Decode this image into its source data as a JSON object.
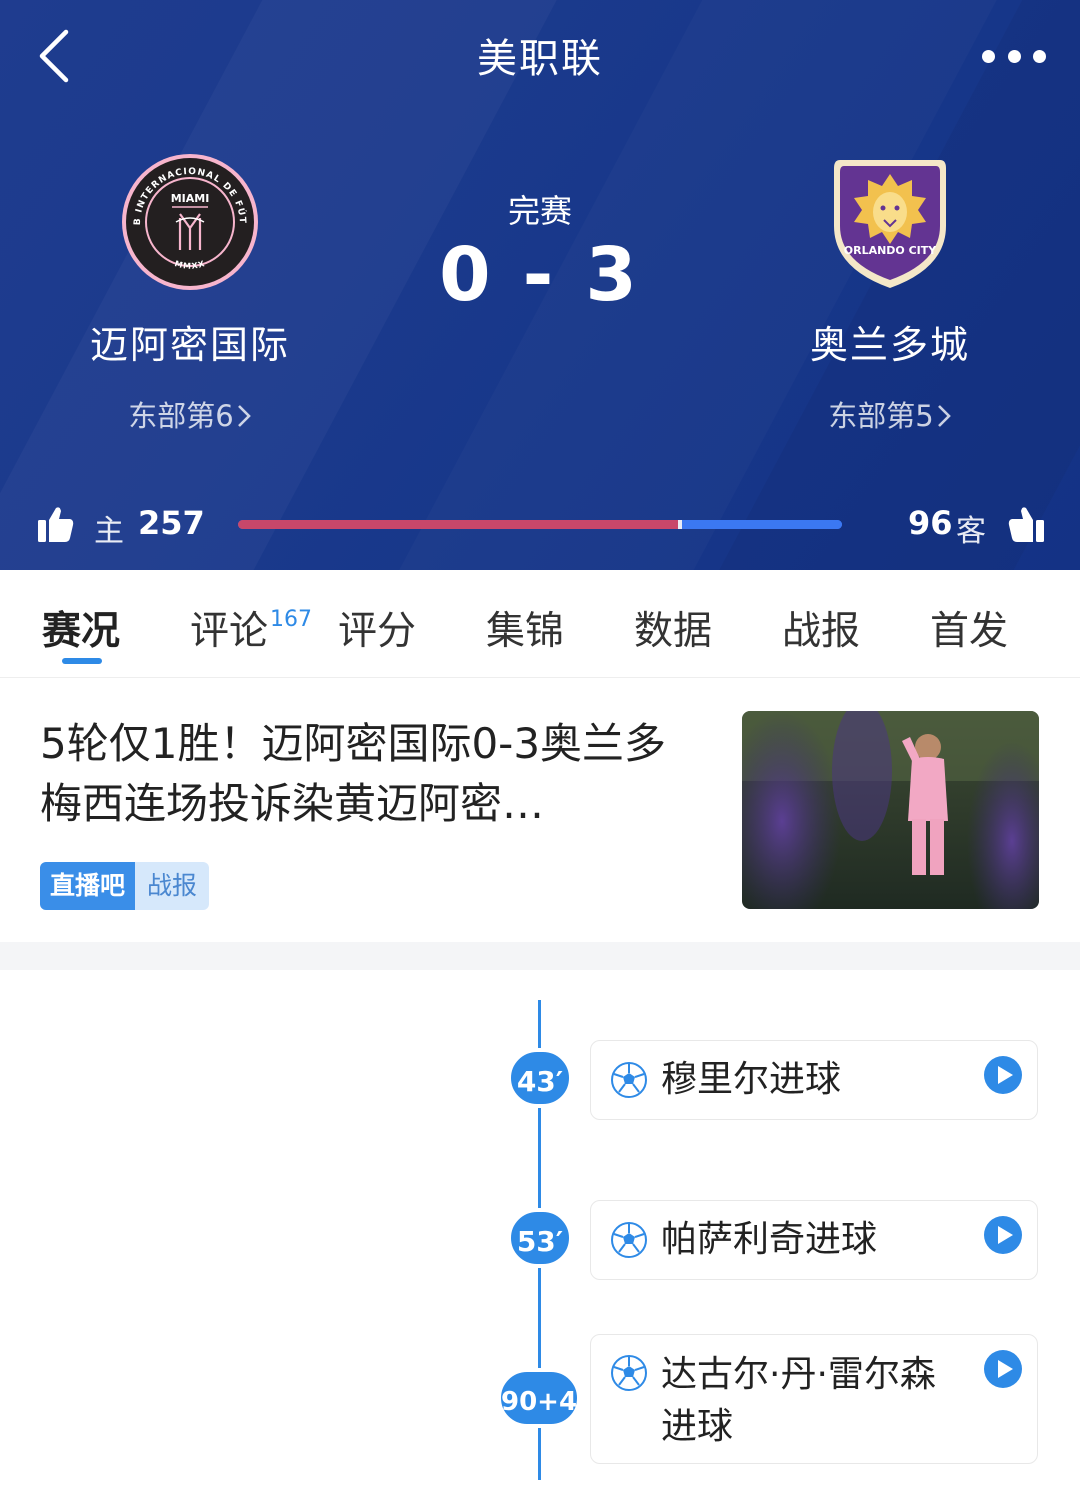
{
  "header": {
    "title": "美职联",
    "status": "完赛",
    "score": {
      "home": "0",
      "separator": "-",
      "away": "3"
    },
    "home_team": {
      "name": "迈阿密国际",
      "rank": "东部第6",
      "logo_text_top": "CLUB INTERNACIONAL DE FÚTBOL",
      "logo_text_center": "MIAMI",
      "logo_text_bottom": "MMXX"
    },
    "away_team": {
      "name": "奥兰多城",
      "rank": "东部第5",
      "logo_text": "ORLANDO CITY"
    },
    "vote": {
      "home_label": "主",
      "home_count": "257",
      "away_count": "96",
      "away_label": "客",
      "home_share": 0.728
    },
    "colors": {
      "background": "#1b3a8c",
      "home_bar": "#c8476a",
      "away_bar": "#3b78f2"
    }
  },
  "tabs": [
    {
      "label": "赛况",
      "active": true
    },
    {
      "label": "评论",
      "badge": "167"
    },
    {
      "label": "评分"
    },
    {
      "label": "集锦"
    },
    {
      "label": "数据"
    },
    {
      "label": "战报"
    },
    {
      "label": "首发"
    }
  ],
  "article": {
    "title": "5轮仅1胜！迈阿密国际0-3奥兰多 梅西连场投诉染黄迈阿密…",
    "tag_brand": "直播吧",
    "tag_kind": "战报"
  },
  "timeline": [
    {
      "minute": "43′",
      "text": "穆里尔进球",
      "icon": "soccer-ball-icon"
    },
    {
      "minute": "53′",
      "text": "帕萨利奇进球",
      "icon": "soccer-ball-icon"
    },
    {
      "minute": "90+4′",
      "text": "达古尔·丹·雷尔森进球",
      "icon": "soccer-ball-icon"
    }
  ],
  "accent_color": "#2e8ae6"
}
